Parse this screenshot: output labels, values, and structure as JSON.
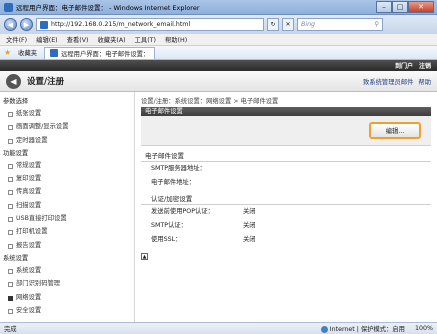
{
  "window": {
    "title": "远程用户界面：电子邮件设置：                      - Windows Internet Explorer",
    "minimize": "–",
    "maximize": "□",
    "close": "✕"
  },
  "address": {
    "back": "◀",
    "forward": "▶",
    "url": "http://192.168.0.215/m_network_email.html",
    "refresh": "↻",
    "stop": "✕",
    "search_placeholder": "Bing",
    "search_icon": "⚲"
  },
  "menu": [
    "文件(F)",
    "编辑(E)",
    "查看(V)",
    "收藏夹(A)",
    "工具(T)",
    "帮助(H)"
  ],
  "favorites": {
    "label": "收藏夹",
    "tab": "远程用户界面：电子邮件设置：",
    "star_color": "#e2a520"
  },
  "page": {
    "top_links": [
      "到门户",
      "注销"
    ],
    "title": "设置/注册",
    "header_links": [
      "致系统管理员邮件",
      "帮助"
    ],
    "sidebar": [
      {
        "type": "group",
        "label": "参数选择"
      },
      {
        "type": "item",
        "label": "纸张设置"
      },
      {
        "type": "item",
        "label": "画面调整/显示设置"
      },
      {
        "type": "item",
        "label": "定时器设置"
      },
      {
        "type": "group",
        "label": "功能设置"
      },
      {
        "type": "item",
        "label": "常规设置"
      },
      {
        "type": "item",
        "label": "复印设置"
      },
      {
        "type": "item",
        "label": "传真设置"
      },
      {
        "type": "item",
        "label": "扫描设置"
      },
      {
        "type": "item",
        "label": "USB直接打印设置"
      },
      {
        "type": "item",
        "label": "打印机设置"
      },
      {
        "type": "item",
        "label": "报告设置"
      },
      {
        "type": "group",
        "label": "系统设置"
      },
      {
        "type": "item",
        "label": "系统设置"
      },
      {
        "type": "item",
        "label": "部门识别码管理"
      },
      {
        "type": "item",
        "label": "网络设置",
        "active": true
      },
      {
        "type": "item",
        "label": "安全设置"
      }
    ],
    "breadcrumb": "设置/注册：系统设置：网络设置 > 电子邮件设置",
    "section_title": "电子邮件设置",
    "edit_button": "编辑...",
    "email_section": "电子邮件设置",
    "email_rows": [
      {
        "k": "SMTP服务器地址：",
        "v": ""
      },
      {
        "k": "电子邮件地址：",
        "v": ""
      }
    ],
    "auth_section": "认证/加密设置",
    "auth_rows": [
      {
        "k": "发送前使用POP认证：",
        "v": "关闭"
      },
      {
        "k": "SMTP认证：",
        "v": "关闭"
      },
      {
        "k": "使用SSL：",
        "v": "关闭"
      }
    ],
    "to_top": "▲"
  },
  "status": {
    "left": "完成",
    "zone": "Internet | 保护模式：启用",
    "zoom": "100%"
  }
}
